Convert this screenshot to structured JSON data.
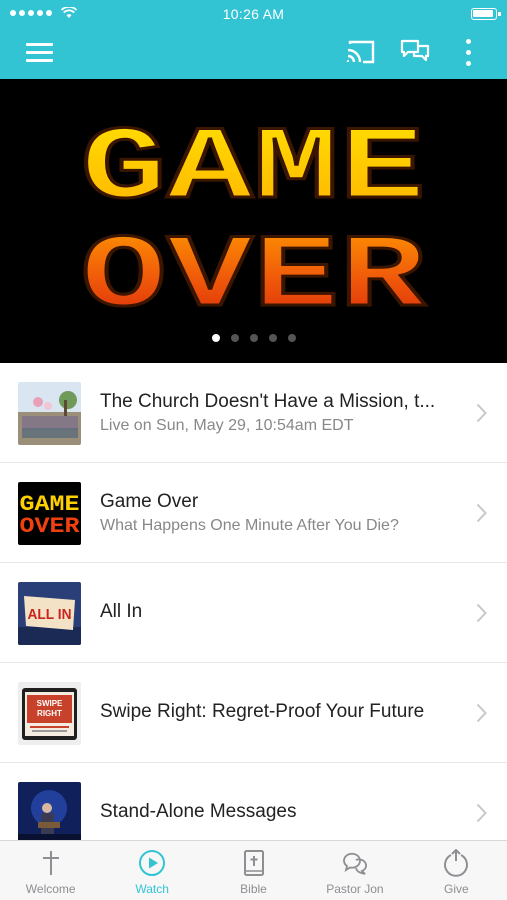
{
  "status_bar": {
    "time": "10:26 AM"
  },
  "header": {
    "icons": [
      "menu-icon",
      "cast-icon",
      "chat-icon",
      "more-vertical-icon"
    ],
    "accent_color": "#33c4d4"
  },
  "hero": {
    "line1": "GAME",
    "line2": "OVER",
    "slide_count": 5,
    "active_slide": 1
  },
  "list": {
    "items": [
      {
        "title": "The Church Doesn't Have a Mission, t...",
        "subtitle": "Live on Sun, May 29, 10:54am EDT"
      },
      {
        "title": "Game Over",
        "subtitle": "What Happens One Minute After You Die?",
        "thumb_line1": "GAME",
        "thumb_line2": "OVER"
      },
      {
        "title": "All In",
        "subtitle": "",
        "thumb_text": "ALL IN"
      },
      {
        "title": "Swipe Right: Regret-Proof Your Future",
        "subtitle": "",
        "thumb_text_1": "SWIPE",
        "thumb_text_2": "RIGHT"
      },
      {
        "title": "Stand-Alone Messages",
        "subtitle": ""
      }
    ]
  },
  "tabs": [
    {
      "label": "Welcome",
      "icon": "cross-icon",
      "active": false
    },
    {
      "label": "Watch",
      "icon": "play-icon",
      "active": true
    },
    {
      "label": "Bible",
      "icon": "bible-icon",
      "active": false
    },
    {
      "label": "Pastor Jon",
      "icon": "chat-bubbles-icon",
      "active": false
    },
    {
      "label": "Give",
      "icon": "power-icon",
      "active": false
    }
  ],
  "colors": {
    "accent": "#33c4d4",
    "inactive_tab": "#8e8e93",
    "hero_top": "#ffd400",
    "hero_bottom": "#e8300a"
  }
}
